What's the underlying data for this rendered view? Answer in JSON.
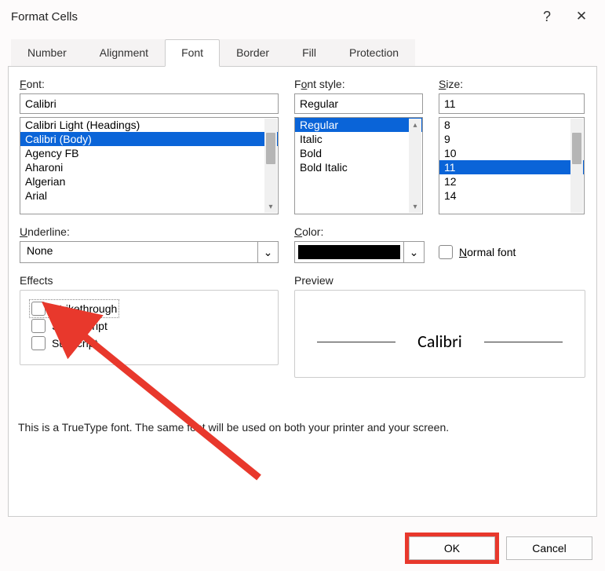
{
  "title": "Format Cells",
  "help_glyph": "?",
  "close_glyph": "✕",
  "tabs": [
    "Number",
    "Alignment",
    "Font",
    "Border",
    "Fill",
    "Protection"
  ],
  "active_tab": 2,
  "font": {
    "label": "Font:",
    "value": "Calibri",
    "items": [
      "Calibri Light (Headings)",
      "Calibri (Body)",
      "Agency FB",
      "Aharoni",
      "Algerian",
      "Arial"
    ],
    "selected_index": 1
  },
  "font_style": {
    "label": "Font style:",
    "value": "Regular",
    "items": [
      "Regular",
      "Italic",
      "Bold",
      "Bold Italic"
    ],
    "selected_index": 0
  },
  "size": {
    "label": "Size:",
    "value": "11",
    "items": [
      "8",
      "9",
      "10",
      "11",
      "12",
      "14"
    ],
    "selected_index": 3
  },
  "underline": {
    "label": "Underline:",
    "value": "None"
  },
  "color": {
    "label": "Color:",
    "value": "#000000"
  },
  "normal_font_label": "Normal font",
  "effects": {
    "label": "Effects",
    "strikethrough": "Strikethrough",
    "superscript": "Superscript",
    "subscript": "Subscript"
  },
  "preview": {
    "label": "Preview",
    "sample": "Calibri"
  },
  "footer": "This is a TrueType font.  The same font will be used on both your printer and your screen.",
  "buttons": {
    "ok": "OK",
    "cancel": "Cancel"
  },
  "chevron": "⌄"
}
